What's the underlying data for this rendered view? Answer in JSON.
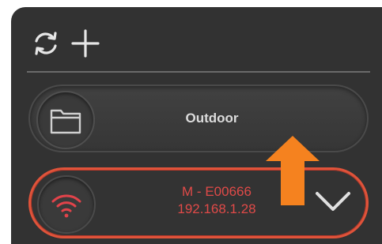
{
  "toolbar": {
    "refresh_icon": "refresh-icon",
    "add_icon": "plus-icon"
  },
  "location": {
    "icon": "folder-icon",
    "name": "Outdoor"
  },
  "device": {
    "icon": "wifi-icon",
    "name": "M - E00666",
    "ip": "192.168.1.28",
    "expand_icon": "chevron-down-icon",
    "accent_color": "#e0533a"
  },
  "overlay": {
    "icon": "arrow-up-icon",
    "color": "#f5821f"
  }
}
